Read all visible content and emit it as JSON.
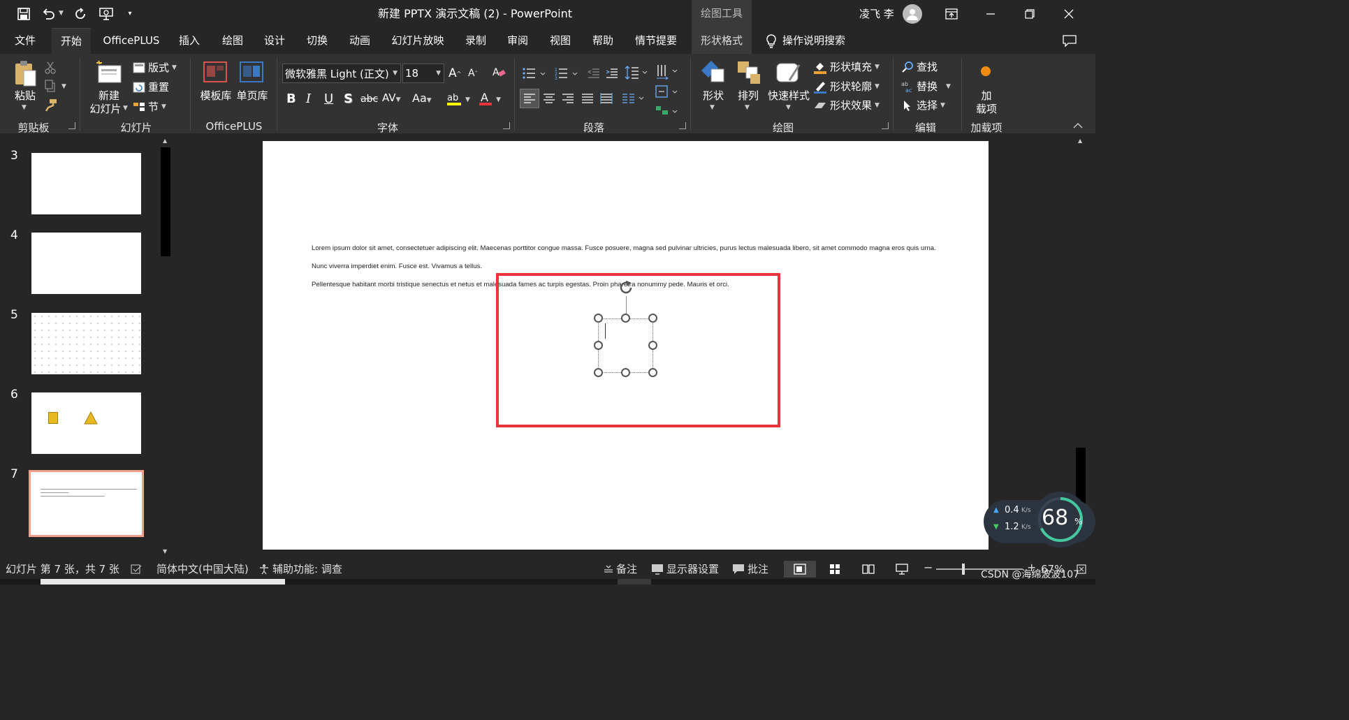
{
  "window": {
    "title": "新建 PPTX 演示文稿 (2)  -  PowerPoint",
    "context_tool": "绘图工具",
    "user_name": "凌飞 李"
  },
  "tabs": [
    {
      "label": "文件"
    },
    {
      "label": "开始"
    },
    {
      "label": "OfficePLUS"
    },
    {
      "label": "插入"
    },
    {
      "label": "绘图"
    },
    {
      "label": "设计"
    },
    {
      "label": "切换"
    },
    {
      "label": "动画"
    },
    {
      "label": "幻灯片放映"
    },
    {
      "label": "录制"
    },
    {
      "label": "审阅"
    },
    {
      "label": "视图"
    },
    {
      "label": "帮助"
    },
    {
      "label": "情节提要"
    },
    {
      "label": "形状格式"
    }
  ],
  "search_label": "操作说明搜索",
  "ribbon": {
    "clipboard": {
      "paste": "粘贴",
      "group": "剪贴板"
    },
    "slides": {
      "new_slide_1": "新建",
      "new_slide_2": "幻灯片",
      "layout": "版式",
      "reset": "重置",
      "section": "节",
      "group": "幻灯片"
    },
    "officeplus": {
      "template": "模板库",
      "single_page": "单页库",
      "group": "OfficePLUS"
    },
    "font": {
      "name": "微软雅黑 Light (正文)",
      "size": "18",
      "group": "字体"
    },
    "paragraph": {
      "group": "段落"
    },
    "drawing": {
      "shape": "形状",
      "arrange": "排列",
      "quick_style": "快速样式",
      "fill": "形状填充",
      "outline": "形状轮廓",
      "effect": "形状效果",
      "group": "绘图"
    },
    "editing": {
      "find": "查找",
      "replace": "替换",
      "select": "选择",
      "group": "编辑"
    },
    "addins": {
      "label_1": "加",
      "label_2": "载项",
      "group": "加载项"
    }
  },
  "slides": [
    {
      "number": "3"
    },
    {
      "number": "4"
    },
    {
      "number": "5"
    },
    {
      "number": "6"
    },
    {
      "number": "7"
    }
  ],
  "slide_text": {
    "line1": "Lorem ipsum dolor sit amet, consectetuer adipiscing elit. Maecenas porttitor congue massa. Fusce posuere, magna sed pulvinar ultricies, purus lectus malesuada libero, sit amet commodo magna eros quis urna.",
    "line2": "Nunc viverra imperdiet enim. Fusce est. Vivamus a tellus.",
    "line3": "Pellentesque habitant morbi tristique senectus et netus et malesuada fames ac turpis egestas. Proin pharetra nonummy pede. Mauris et orci."
  },
  "network": {
    "up": "0.4",
    "down": "1.2",
    "unit": "K/s",
    "percent": "68",
    "percent_sign": "%"
  },
  "status": {
    "slide_info": "幻灯片 第 7 张，共 7 张",
    "language": "简体中文(中国大陆)",
    "accessibility": "辅助功能: 调查",
    "notes": "备注",
    "display": "显示器设置",
    "comments": "批注",
    "zoom": "67%"
  },
  "watermark": "CSDN @海绵波波107",
  "colors": {
    "accent": "#b7472a",
    "highlight_red": "#e8343a",
    "selected_thumb": "#f0a08a"
  }
}
